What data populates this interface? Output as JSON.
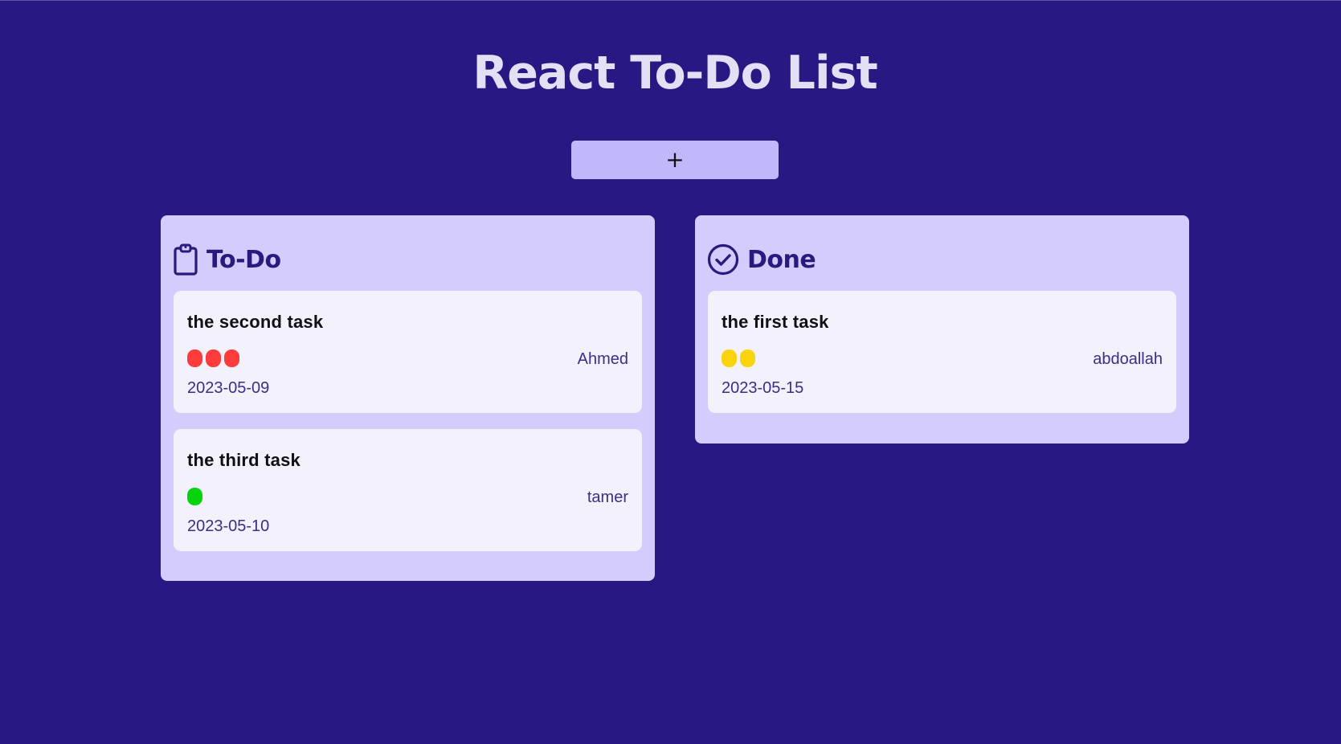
{
  "app": {
    "title": "React To-Do List",
    "add_button_label": "+"
  },
  "colors": {
    "background": "#281884",
    "column_bg": "#d4ccfc",
    "card_bg": "#f2f1fc",
    "accent": "#2a1a7d",
    "add_button": "#c1b7fb"
  },
  "columns": [
    {
      "title": "To-Do",
      "icon": "clipboard-icon",
      "tasks": [
        {
          "title": "the second task",
          "priority": 3,
          "priority_color": "#ff3b3b",
          "assignee": "Ahmed",
          "date": "2023-05-09"
        },
        {
          "title": "the third task",
          "priority": 1,
          "priority_color": "#05d30b",
          "assignee": "tamer",
          "date": "2023-05-10"
        }
      ]
    },
    {
      "title": "Done",
      "icon": "check-circle-icon",
      "tasks": [
        {
          "title": "the first task",
          "priority": 2,
          "priority_color": "#f9d40e",
          "assignee": "abdoallah",
          "date": "2023-05-15"
        }
      ]
    }
  ]
}
